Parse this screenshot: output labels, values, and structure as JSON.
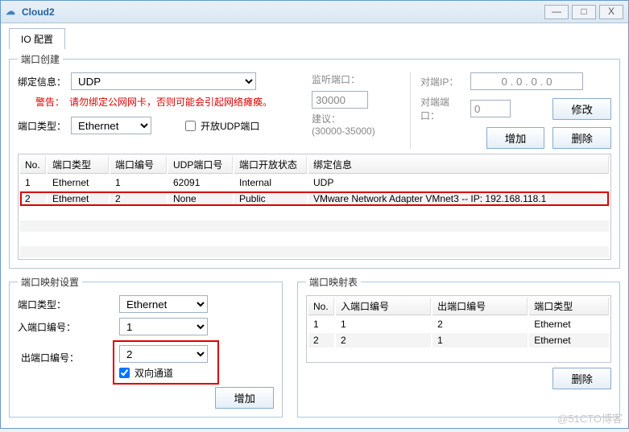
{
  "window": {
    "title": "Cloud2",
    "min": "—",
    "max": "□",
    "close": "X"
  },
  "tabs": {
    "io": "IO 配置"
  },
  "portCreate": {
    "legend": "端口创建",
    "bindLabel": "绑定信息：",
    "bindValue": "UDP",
    "warnLabel": "警告：",
    "warnText": "请勿绑定公网网卡，否则可能会引起网络瘫痪。",
    "typeLabel": "端口类型：",
    "typeValue": "Ethernet",
    "openUdp": "开放UDP端口",
    "listenLabel": "监听端口：",
    "listenValue": "30000",
    "suggestLabel": "建议：",
    "suggestRange": "(30000-35000)",
    "peerIpLabel": "对端IP：",
    "peerIpValue": "0 . 0 . 0 . 0",
    "peerPortLabel": "对端端口：",
    "peerPortValue": "0",
    "modify": "修改",
    "add": "增加",
    "del": "删除",
    "cols": {
      "no": "No.",
      "type": "端口类型",
      "num": "端口编号",
      "udp": "UDP端口号",
      "open": "端口开放状态",
      "bind": "绑定信息"
    },
    "rows": [
      {
        "no": "1",
        "type": "Ethernet",
        "num": "1",
        "udp": "62091",
        "open": "Internal",
        "bind": "UDP"
      },
      {
        "no": "2",
        "type": "Ethernet",
        "num": "2",
        "udp": "None",
        "open": "Public",
        "bind": "VMware Network Adapter VMnet3 -- IP: 192.168.118.1"
      }
    ]
  },
  "mapSet": {
    "legend": "端口映射设置",
    "typeLabel": "端口类型：",
    "typeValue": "Ethernet",
    "inLabel": "入端口编号：",
    "inValue": "1",
    "outLabel": "出端口编号：",
    "outValue": "2",
    "bidir": "双向通道",
    "add": "增加"
  },
  "mapTable": {
    "legend": "端口映射表",
    "cols": {
      "no": "No.",
      "in": "入端口编号",
      "out": "出端口编号",
      "type": "端口类型"
    },
    "rows": [
      {
        "no": "1",
        "in": "1",
        "out": "2",
        "type": "Ethernet"
      },
      {
        "no": "2",
        "in": "2",
        "out": "1",
        "type": "Ethernet"
      }
    ],
    "del": "删除"
  },
  "watermark": "@51CTO博客"
}
